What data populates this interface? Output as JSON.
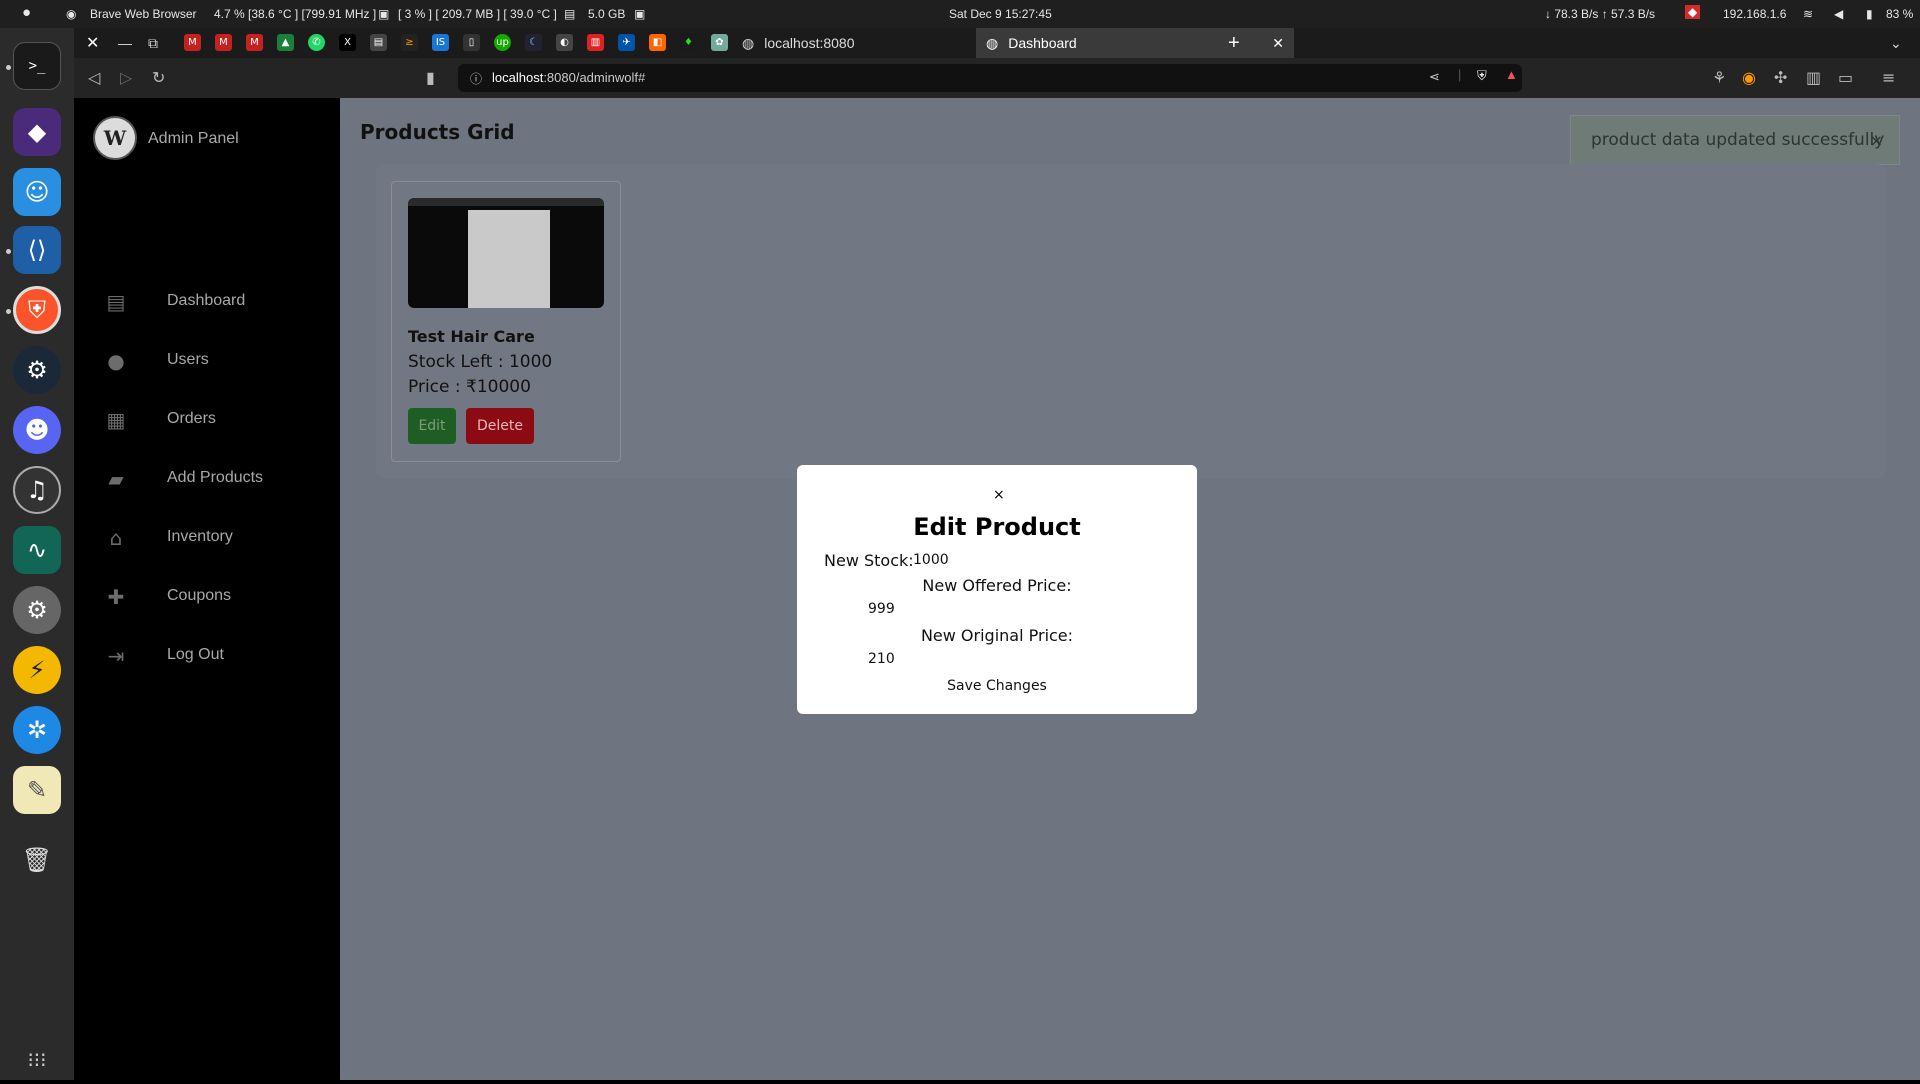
{
  "topbar": {
    "app": "Brave Web Browser",
    "cpu": "4.7 % [38.6 °C ] [799.91 MHz ]",
    "gpu": "[ 3 % ] [ 209.7 MB ] [ 39.0 °C ]",
    "mem": "5.0 GB",
    "clock": "Sat Dec 9  15:27:45",
    "net": "↓ 78.3 B/s ↑ 57.3 B/s",
    "ip": "192.168.1.6",
    "battery": "83 %"
  },
  "tabs": {
    "inactive": "localhost:8080",
    "active": "Dashboard",
    "new_tab": "+"
  },
  "url": {
    "host": "localhost",
    "path": ":8080/adminwolf#"
  },
  "sidebar": {
    "brand": "Admin Panel",
    "items": [
      {
        "label": "Dashboard",
        "icon": "id-card-icon"
      },
      {
        "label": "Users",
        "icon": "user-icon"
      },
      {
        "label": "Orders",
        "icon": "store-icon"
      },
      {
        "label": "Add Products",
        "icon": "bag-icon"
      },
      {
        "label": "Inventory",
        "icon": "warehouse-icon"
      },
      {
        "label": "Coupons",
        "icon": "gift-icon"
      },
      {
        "label": "Log Out",
        "icon": "logout-icon"
      }
    ]
  },
  "main": {
    "title": "Products Grid",
    "toast": "product data updated successfully",
    "toast_close": "×"
  },
  "product": {
    "name": "Test Hair Care",
    "stock": "Stock Left : 1000",
    "price": "Price : ₹10000",
    "edit": "Edit",
    "delete": "Delete"
  },
  "modal": {
    "close": "×",
    "title": "Edit Product",
    "stock_label": "New Stock:",
    "stock_value": "1000",
    "offered_label": "New Offered Price:",
    "offered_value": "999",
    "original_label": "New Original Price:",
    "original_value": "210",
    "save": "Save Changes"
  },
  "colors": {
    "sidebar": "#000000",
    "overlay": "#6f7580",
    "edit": "#1e5e24",
    "delete": "#8c0b12",
    "toast": "#6f7b76"
  }
}
